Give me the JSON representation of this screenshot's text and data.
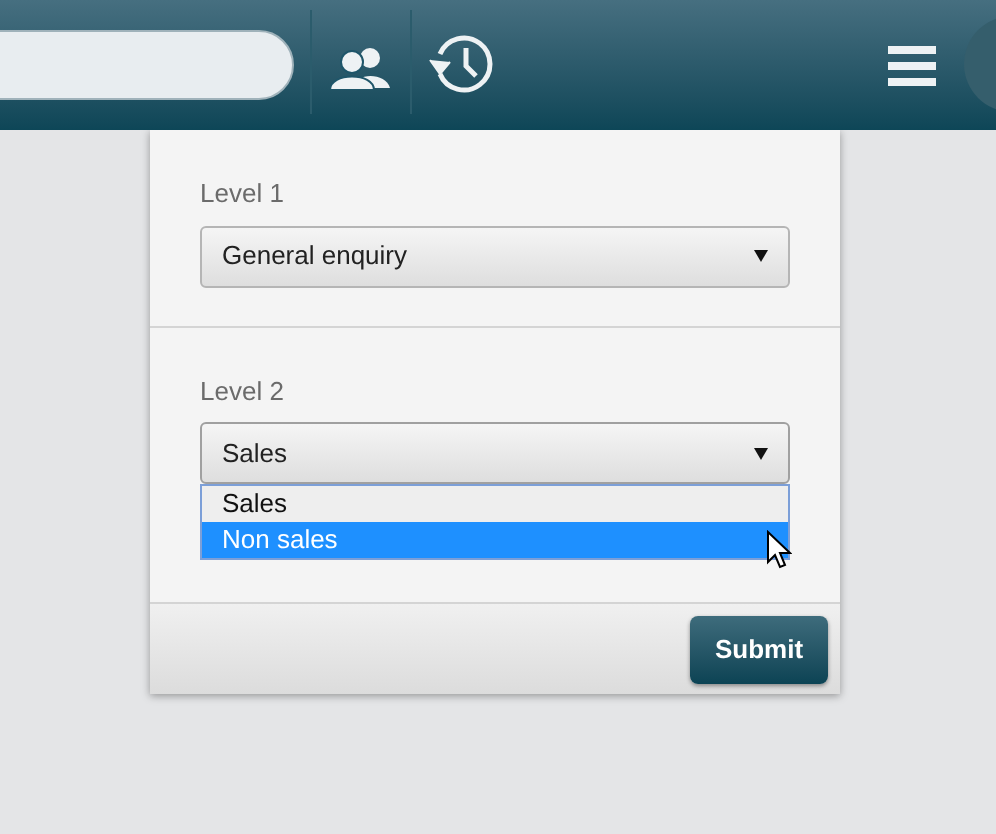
{
  "levels": [
    {
      "label": "Level 1",
      "value": "General enquiry",
      "expanded": false
    },
    {
      "label": "Level 2",
      "value": "Sales",
      "expanded": true,
      "options": [
        {
          "label": "Sales",
          "highlighted": false
        },
        {
          "label": "Non sales",
          "highlighted": true
        }
      ]
    }
  ],
  "submit_button": "Submit"
}
